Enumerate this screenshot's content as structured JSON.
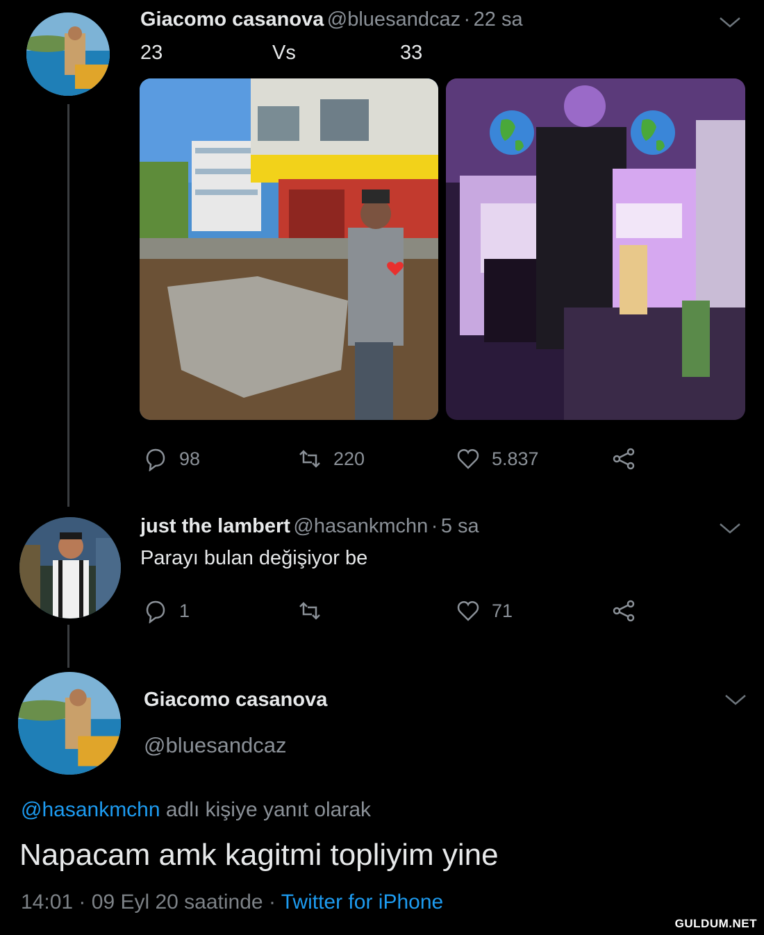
{
  "tweet1": {
    "name": "Giacomo casanova",
    "handle": "@bluesandcaz",
    "sep": "·",
    "time": "22 sa",
    "text_left": "23",
    "text_mid": "Vs",
    "text_right": "33",
    "replies": "98",
    "retweets": "220",
    "likes": "5.837"
  },
  "tweet2": {
    "name": "just the lambert",
    "handle": "@hasankmchn",
    "sep": "·",
    "time": "5 sa",
    "text": "Parayı bulan değişiyor be",
    "replies": "1",
    "likes": "71"
  },
  "tweet3": {
    "name": "Giacomo casanova",
    "handle": "@bluesandcaz",
    "reply_to_handle": "@hasankmchn",
    "reply_to_suffix": "adlı kişiye yanıt olarak",
    "text": "Napacam amk kagitmi topliyim yine",
    "time": "14:01",
    "dot": "·",
    "date": "09 Eyl 20 saatinde",
    "source": "Twitter for iPhone"
  },
  "watermark": "GULDUM.NET",
  "colors": {
    "background": "#000000",
    "link": "#1d9bf0",
    "muted": "#8b9198"
  }
}
